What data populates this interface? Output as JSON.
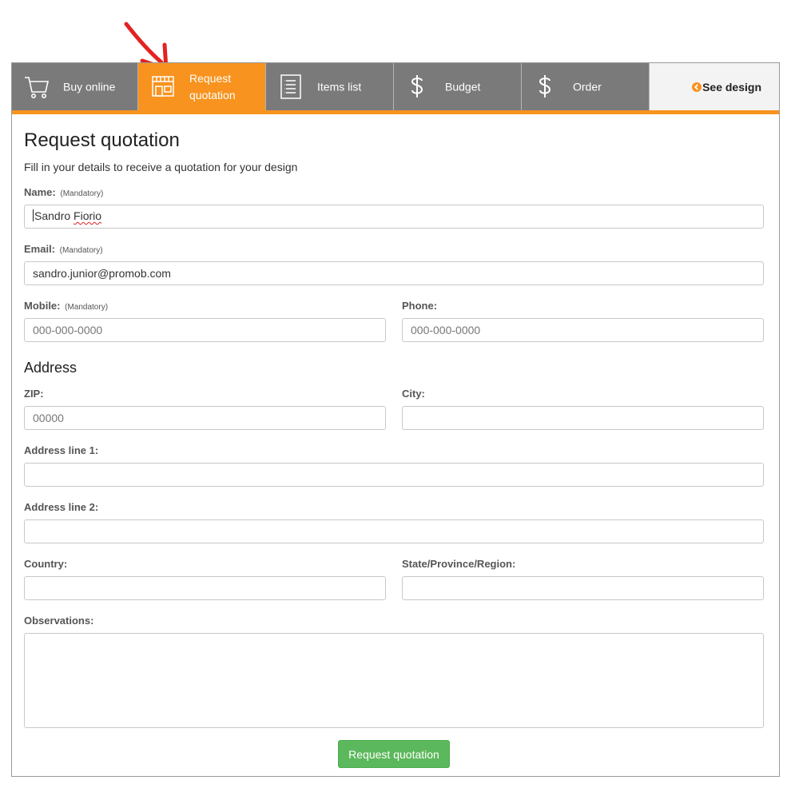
{
  "tabs": [
    {
      "label": "Buy online",
      "icon": "cart-icon",
      "active": false
    },
    {
      "label_line1": "Request",
      "label_line2": "quotation",
      "icon": "storefront-icon",
      "active": true
    },
    {
      "label": "Items list",
      "icon": "list-document-icon",
      "active": false
    },
    {
      "label": "Budget",
      "icon": "dollar-icon",
      "active": false
    },
    {
      "label": "Order",
      "icon": "dollar-icon",
      "active": false
    }
  ],
  "see_design": {
    "label": "See design",
    "icon": "chevron-left-circle-icon"
  },
  "annotation": {
    "icon": "red-arrow-icon",
    "color": "#e32222"
  },
  "form": {
    "title": "Request quotation",
    "subtitle": "Fill in your details to receive a quotation for your design",
    "mandatory_note": "(Mandatory)",
    "name": {
      "label": "Name:",
      "value_part1": "Sandro",
      "value_part2": "Fiorio"
    },
    "email": {
      "label": "Email:",
      "value": "sandro.junior@promob.com"
    },
    "mobile": {
      "label": "Mobile:",
      "placeholder": "000-000-0000"
    },
    "phone": {
      "label": "Phone:",
      "placeholder": "000-000-0000"
    },
    "address_heading": "Address",
    "zip": {
      "label": "ZIP:",
      "placeholder": "00000"
    },
    "city": {
      "label": "City:",
      "placeholder": ""
    },
    "address1": {
      "label": "Address line 1:",
      "placeholder": ""
    },
    "address2": {
      "label": "Address line 2:",
      "placeholder": ""
    },
    "country": {
      "label": "Country:",
      "placeholder": ""
    },
    "state": {
      "label": "State/Province/Region:",
      "placeholder": ""
    },
    "observations": {
      "label": "Observations:",
      "placeholder": ""
    },
    "submit_label": "Request quotation"
  },
  "colors": {
    "accent": "#f7931e",
    "tab_bg": "#7a7a7a",
    "submit": "#5cb85c"
  }
}
